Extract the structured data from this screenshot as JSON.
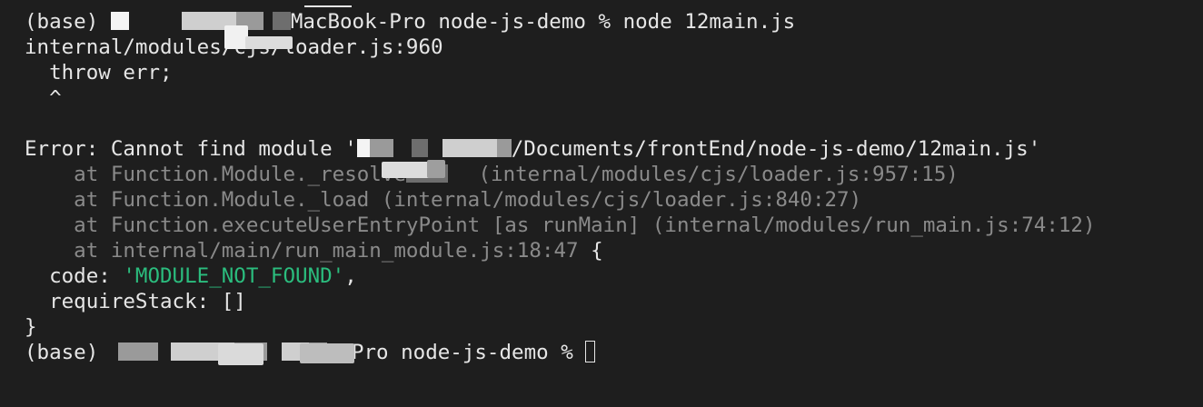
{
  "terminal": {
    "lines": [
      {
        "a": "(base) ",
        "b": "MacBook-Pro node-js-demo % node 12main.js"
      },
      {
        "text": "internal/modules/cjs/loader.js:960"
      },
      {
        "text": "  throw err;"
      },
      {
        "text": "  ^"
      },
      {
        "text": ""
      },
      {
        "a": "Error: Cannot find module '",
        "b": "/Documents/frontEnd/node-js-demo/12main.js'"
      },
      {
        "a": "    at Function.Module._resolve",
        "b": " (internal/modules/cjs/loader.js:957:15)"
      },
      {
        "text": "    at Function.Module._load (internal/modules/cjs/loader.js:840:27)"
      },
      {
        "text": "    at Function.executeUserEntryPoint [as runMain] (internal/modules/run_main.js:74:12)"
      },
      {
        "a": "    at internal/main/run_main_module.js:18:47",
        "b": " {"
      },
      {
        "a": "  code: ",
        "b": "'MODULE_NOT_FOUND'",
        "c": ","
      },
      {
        "text": "  requireStack: []"
      },
      {
        "text": "}"
      },
      {
        "a": "(base) ",
        "b": "k-Pro node-js-demo % "
      }
    ]
  },
  "colors": {
    "background": "#1e1e1e",
    "foreground": "#e6e6e6",
    "dim": "#8a8a8a",
    "string": "#2bbd7e"
  }
}
